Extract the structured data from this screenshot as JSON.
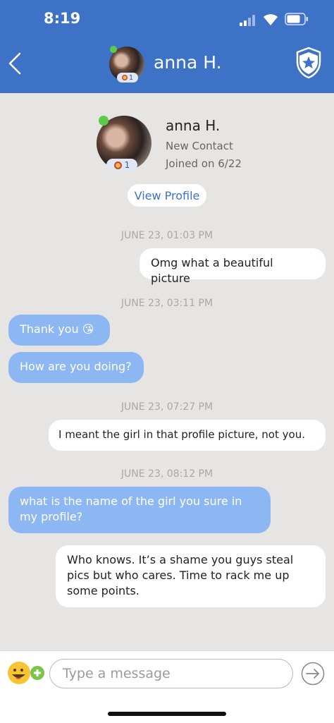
{
  "status_bar": {
    "time": "8:19"
  },
  "header": {
    "contact_name": "anna H.",
    "badge_count": "1"
  },
  "profile": {
    "name": "anna H.",
    "subtitle": "New Contact",
    "joined": "Joined on 6/22",
    "badge_count": "1",
    "view_profile_label": "View Profile"
  },
  "conversation": {
    "stamp_1": "JUNE 23, 01:03 PM",
    "msg_1": "Omg what a beautiful picture",
    "stamp_2": "JUNE 23, 03:11 PM",
    "msg_2": "Thank you 😘",
    "msg_3": "How are you doing?",
    "stamp_3": "JUNE 23, 07:27 PM",
    "msg_4": "I meant the girl in that profile picture, not you.",
    "stamp_4": "JUNE 23, 08:12 PM",
    "msg_5": "what is the name of the girl you sure in my profile?",
    "msg_6": "Who knows. It’s a shame you guys steal pics but who cares. Time to rack me up some points."
  },
  "composer": {
    "placeholder": "Type a message",
    "value": ""
  },
  "icons": {
    "back": "chevron-left-icon",
    "safety": "shield-star-icon",
    "emoji": "emoji-plus-icon",
    "send": "send-arrow-icon"
  },
  "colors": {
    "header": "#3d72c7",
    "incoming_bubble": "#8db7f3",
    "outgoing_bubble": "#ffffff",
    "background": "#e6e5e3",
    "online": "#5ccb48"
  }
}
